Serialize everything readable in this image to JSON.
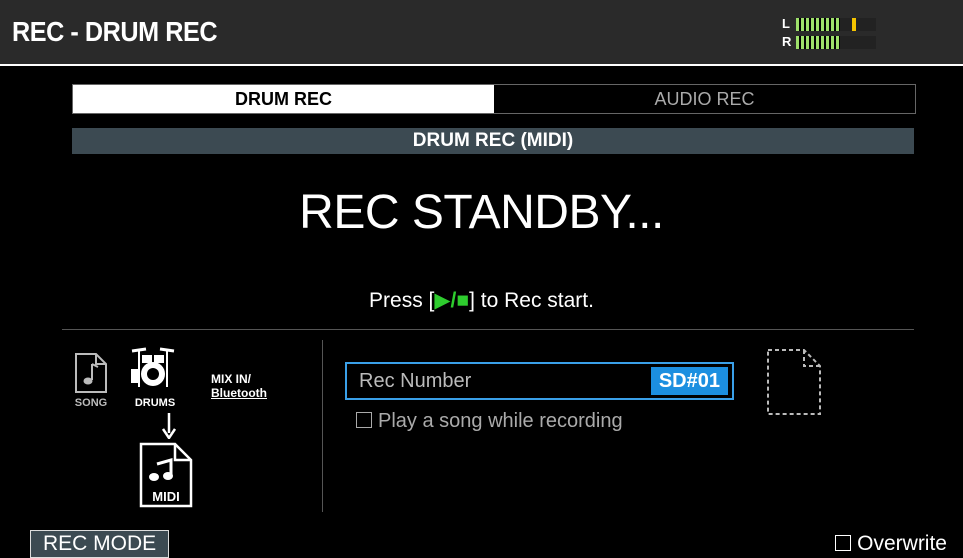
{
  "header": {
    "title": "REC - DRUM REC",
    "meter": {
      "left_label": "L",
      "right_label": "R",
      "left_level": 0.7,
      "right_level": 0.55,
      "peak_color": "#f5c400"
    }
  },
  "tabs": [
    {
      "label": "DRUM REC",
      "active": true
    },
    {
      "label": "AUDIO REC",
      "active": false
    }
  ],
  "mode_label": "DRUM REC (MIDI)",
  "status_text": "REC STANDBY...",
  "hint": {
    "prefix": "Press [",
    "symbol": "▶/■",
    "suffix": "] to Rec start."
  },
  "sources": {
    "song_label": "SONG",
    "drums_label": "DRUMS",
    "mixin_label": "MIX IN/",
    "bluetooth_label": "Bluetooth",
    "output_label": "MIDI"
  },
  "rec_number": {
    "label": "Rec Number",
    "value": "SD#01"
  },
  "play_song_option": {
    "label": "Play a song while recording",
    "checked": false
  },
  "footer": {
    "rec_mode_label": "REC MODE",
    "overwrite_label": "Overwrite",
    "overwrite_checked": false
  },
  "colors": {
    "accent_blue": "#1c8fe0",
    "play_green": "#2ecc2e",
    "bar_gray": "#3c4a52"
  }
}
